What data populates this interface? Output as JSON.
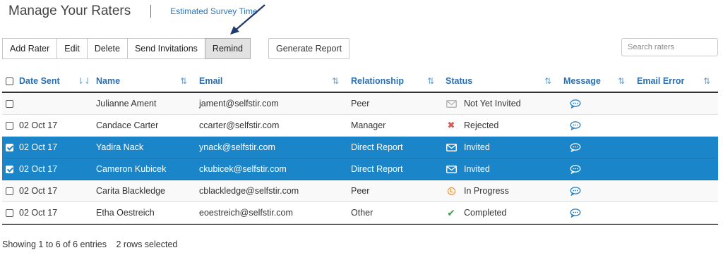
{
  "header": {
    "title": "Manage Your Raters",
    "estimated_link": "Estimated Survey Time"
  },
  "toolbar": {
    "buttons": [
      "Add Rater",
      "Edit",
      "Delete",
      "Send Invitations",
      "Remind"
    ],
    "active": "Remind",
    "generate_report": "Generate Report"
  },
  "search": {
    "placeholder": "Search raters",
    "value": ""
  },
  "table": {
    "columns": [
      "Date Sent",
      "Name",
      "Email",
      "Relationship",
      "Status",
      "Message",
      "Email Error"
    ],
    "rows": [
      {
        "checked": false,
        "selected": false,
        "date": "",
        "name": "Julianne Ament",
        "email": "jament@selfstir.com",
        "relationship": "Peer",
        "status": "Not Yet Invited",
        "status_icon": "envelope-grey-icon",
        "email_error": ""
      },
      {
        "checked": false,
        "selected": false,
        "date": "02 Oct 17",
        "name": "Candace Carter",
        "email": "ccarter@selfstir.com",
        "relationship": "Manager",
        "status": "Rejected",
        "status_icon": "x-icon",
        "email_error": ""
      },
      {
        "checked": true,
        "selected": true,
        "date": "02 Oct 17",
        "name": "Yadira Nack",
        "email": "ynack@selfstir.com",
        "relationship": "Direct Report",
        "status": "Invited",
        "status_icon": "envelope-icon",
        "email_error": ""
      },
      {
        "checked": true,
        "selected": true,
        "date": "02 Oct 17",
        "name": "Cameron Kubicek",
        "email": "ckubicek@selfstir.com",
        "relationship": "Direct Report",
        "status": "Invited",
        "status_icon": "envelope-icon",
        "email_error": ""
      },
      {
        "checked": false,
        "selected": false,
        "date": "02 Oct 17",
        "name": "Carita Blackledge",
        "email": "cblackledge@selfstir.com",
        "relationship": "Peer",
        "status": "In Progress",
        "status_icon": "clock-icon",
        "email_error": ""
      },
      {
        "checked": false,
        "selected": false,
        "date": "02 Oct 17",
        "name": "Etha Oestreich",
        "email": "eoestreich@selfstir.com",
        "relationship": "Other",
        "status": "Completed",
        "status_icon": "check-icon",
        "email_error": ""
      }
    ]
  },
  "footer": {
    "entries": "Showing 1 to 6 of 6 entries",
    "selected": "2 rows selected"
  },
  "colors": {
    "accent": "#2a6fb0",
    "selected_row": "#1a86c9",
    "message_icon": "#1f7bc4"
  }
}
